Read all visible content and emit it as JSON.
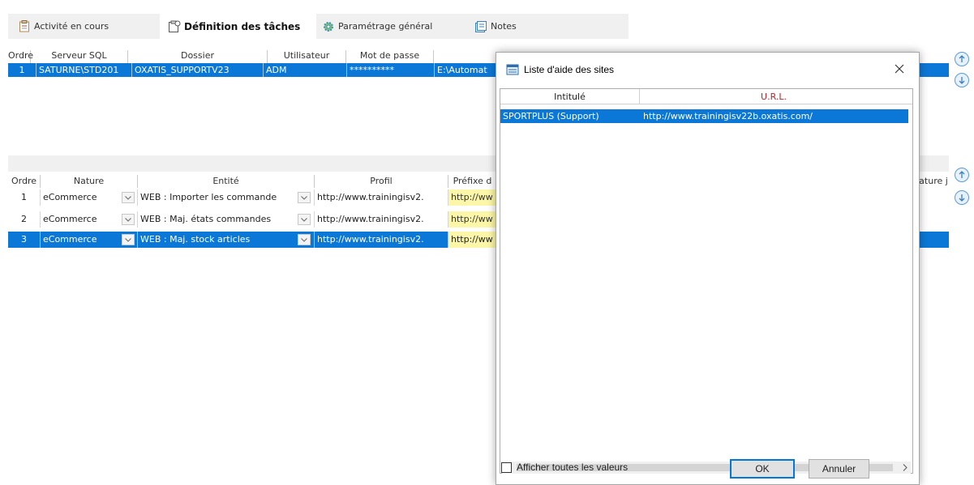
{
  "tabs": [
    {
      "label": "Activité en cours",
      "icon": "clipboard-icon"
    },
    {
      "label": "Définition des tâches",
      "icon": "task-definition-icon",
      "active": true
    },
    {
      "label": "Paramétrage général",
      "icon": "gear-icon"
    },
    {
      "label": "Notes",
      "icon": "notes-icon"
    }
  ],
  "servers_grid": {
    "headers": [
      "Ordre",
      "Serveur SQL",
      "Dossier",
      "Utilisateur",
      "Mot de passe"
    ],
    "rows": [
      {
        "ordre": "1",
        "serveur": "SATURNE\\STD201",
        "dossier": "OXATIS_SUPPORTV23",
        "utilisateur": "ADM",
        "mot_de_passe": "**********",
        "chemin": "E:\\Automat"
      }
    ]
  },
  "tasks_grid": {
    "headers": [
      "Ordre",
      "Nature",
      "Entité",
      "Profil",
      "Préfixe d",
      "ature j"
    ],
    "rows": [
      {
        "ordre": "1",
        "nature": "eCommerce",
        "entite": "WEB : Importer les commande",
        "profil": "http://www.trainingisv2.",
        "prefixe": "http://ww",
        "selected": false
      },
      {
        "ordre": "2",
        "nature": "eCommerce",
        "entite": "WEB : Maj. états commandes",
        "profil": "http://www.trainingisv2.",
        "prefixe": "http://ww",
        "selected": false
      },
      {
        "ordre": "3",
        "nature": "eCommerce",
        "entite": "WEB : Maj. stock articles",
        "profil": "http://www.trainingisv2.",
        "prefixe": "http://ww",
        "selected": true
      }
    ]
  },
  "dialog": {
    "title": "Liste d'aide des sites",
    "columns": {
      "intitule": "Intitulé",
      "url": "U.R.L."
    },
    "url_header_color": "#c0202a",
    "rows": [
      {
        "intitule": "SPORTPLUS (Support)",
        "url": "http://www.trainingisv22b.oxatis.com/"
      }
    ],
    "show_all_label": "Afficher toutes les valeurs",
    "ok_label": "OK",
    "cancel_label": "Annuler"
  },
  "colors": {
    "selection": "#0b78d7",
    "prefix_bg": "#fcf7a8"
  }
}
